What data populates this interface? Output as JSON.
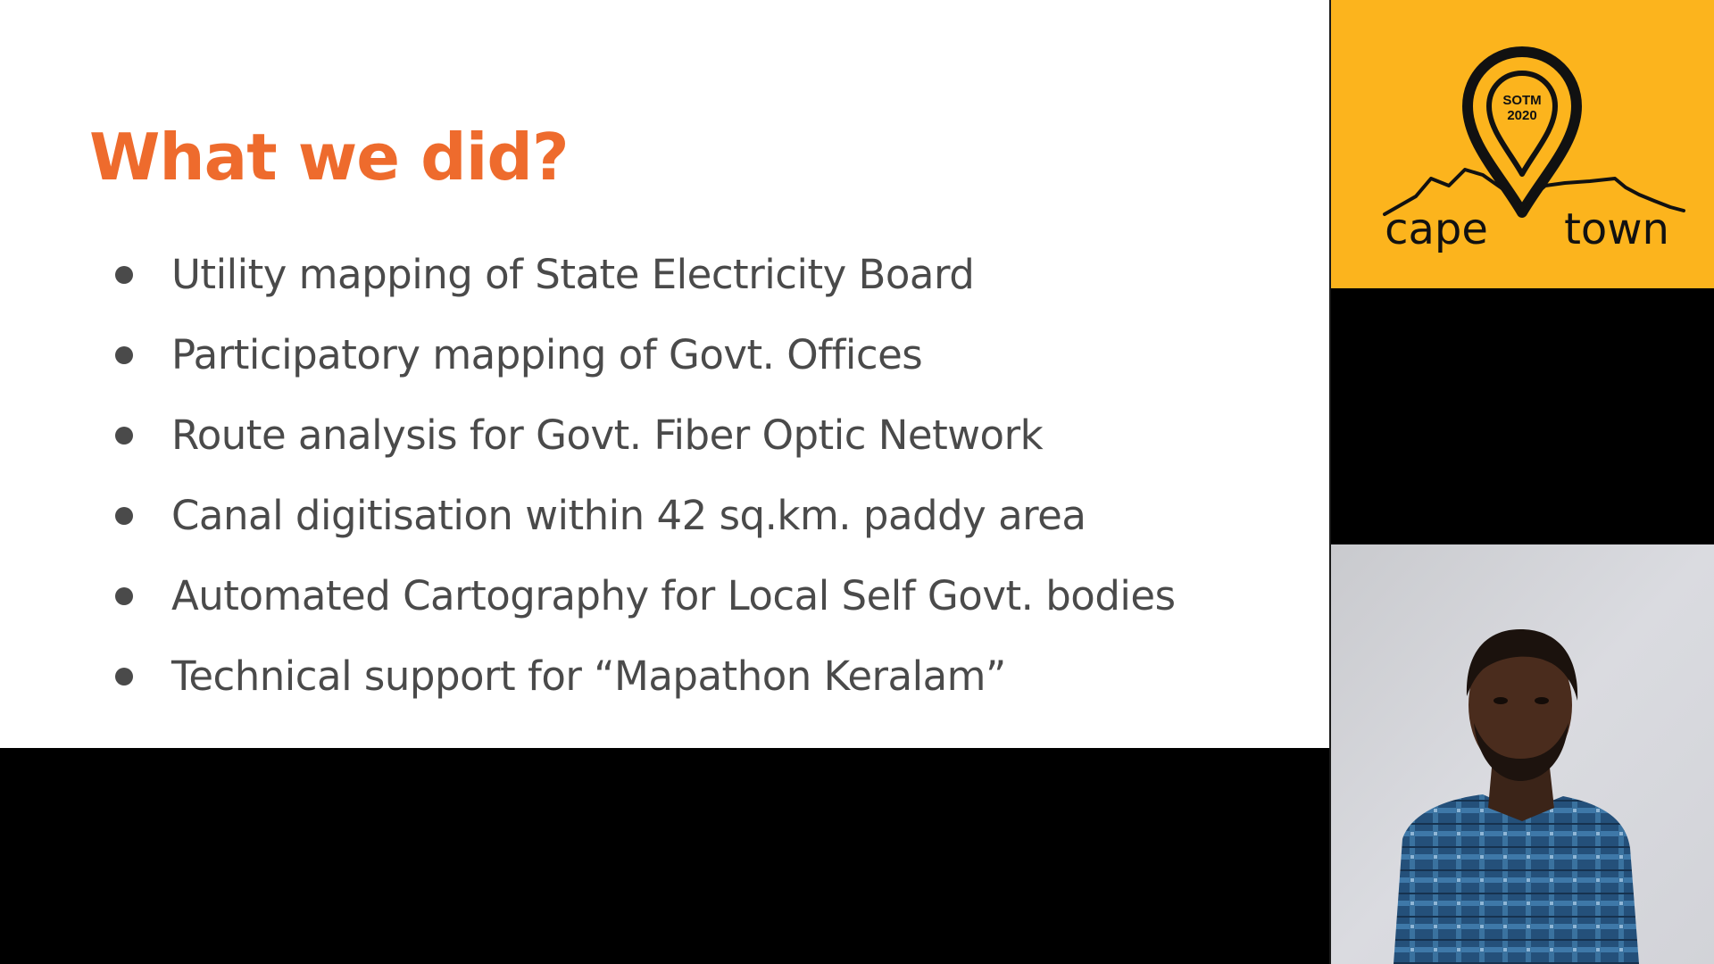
{
  "slide": {
    "title": "What we did?",
    "bullets": [
      "Utility mapping of State Electricity Board",
      "Participatory mapping of Govt. Offices",
      "Route analysis for Govt. Fiber Optic Network",
      "Canal digitisation within 42 sq.km. paddy area",
      "Automated Cartography for Local Self Govt. bodies",
      "Technical support for “Mapathon Keralam”"
    ]
  },
  "logo": {
    "badge_line1": "SOTM",
    "badge_line2": "2020",
    "wordmark_left": "cape",
    "wordmark_right": "town"
  },
  "colors": {
    "title": "#ee6b2d",
    "bullet_text": "#4a4a4a",
    "slide_background": "#ffffff",
    "logo_background": "#fcb41d",
    "frame_background": "#000000",
    "webcam_wall": "#d6d7dc",
    "shirt": "#2a5a86"
  },
  "icons": {
    "logo_pin": "map-pin-icon",
    "mountains": "table-mountain-icon"
  }
}
